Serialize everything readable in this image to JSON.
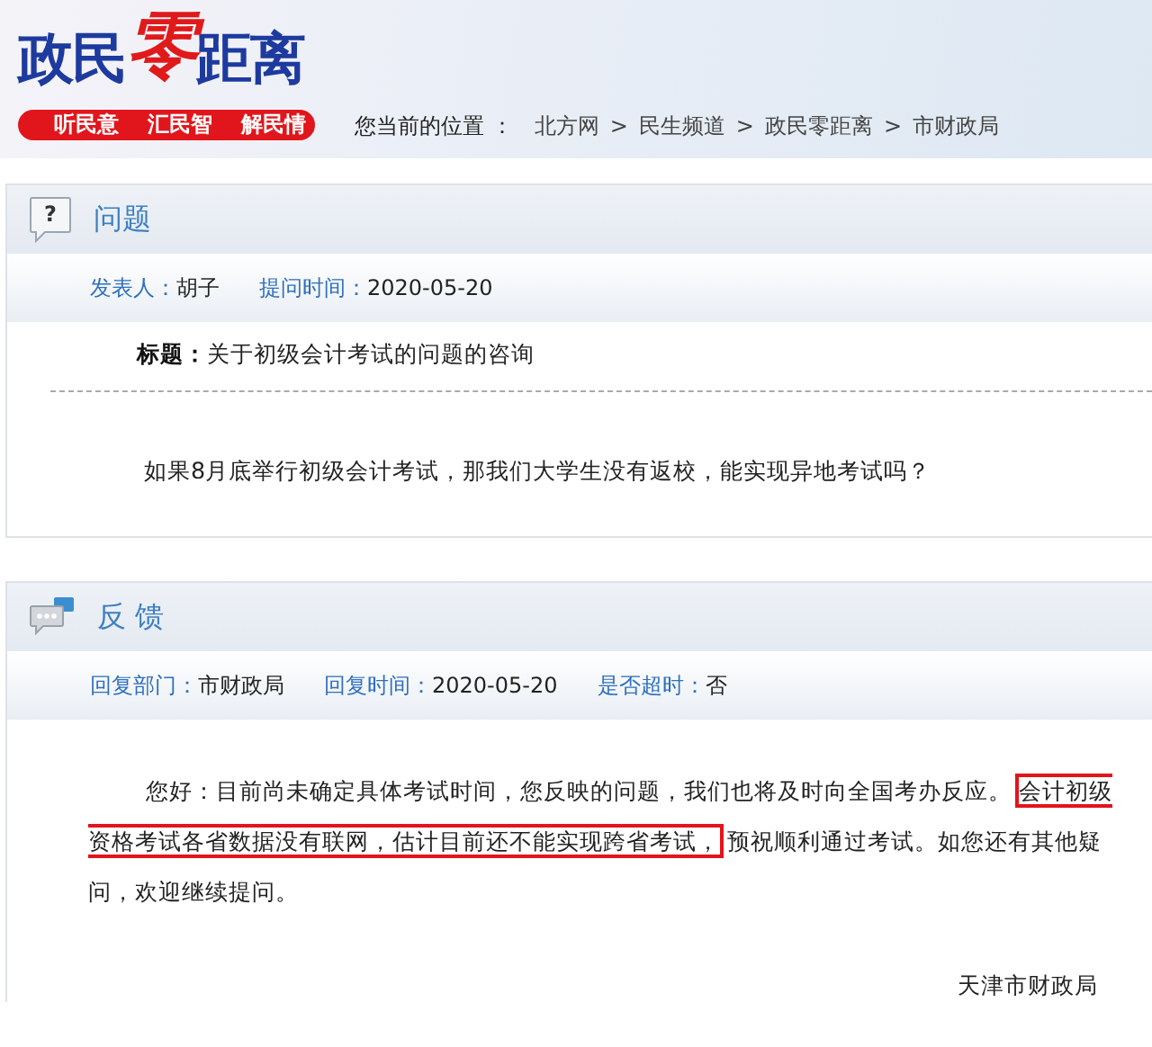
{
  "header": {
    "logo": {
      "before": "政民",
      "accent": "零",
      "after": "距离"
    },
    "slogans": [
      "听民意",
      "汇民智",
      "解民情"
    ],
    "location_label": "您当前的位置 ：",
    "breadcrumb": [
      {
        "text": "北方网"
      },
      {
        "text": "民生频道"
      },
      {
        "text": "政民零距离"
      },
      {
        "text": "市财政局"
      }
    ],
    "separator": ">"
  },
  "panels": [
    {
      "kind": "question",
      "icon_glyph": "?",
      "title": "问题",
      "meta": [
        {
          "label": "发表人：",
          "value": "胡子"
        },
        {
          "label": "提问时间：",
          "value": "2020-05-20"
        }
      ],
      "subject_label": "标题：",
      "subject": "关于初级会计考试的问题的咨询",
      "body": [
        {
          "text": "如果8月底举行初级会计考试，那我们大学生没有返校，能实现异地考试吗？",
          "highlighted": false
        }
      ]
    },
    {
      "kind": "reply",
      "title": "反 馈",
      "meta": [
        {
          "label": "回复部门：",
          "value": "市财政局"
        },
        {
          "label": "回复时间：",
          "value": "2020-05-20"
        },
        {
          "label": "是否超时：",
          "value": "否"
        }
      ],
      "body": [
        {
          "text": "您好：目前尚未确定具体考试时间，您反映的问题，我们也将及时向全国考办反应。",
          "highlighted": false
        },
        {
          "text": "会计初级资格考试各省数据没有联网，估计目前还不能实现跨省考试，",
          "highlighted": true
        },
        {
          "text": "预祝顺利通过考试。如您还有其他疑问，欢迎继续提问。",
          "highlighted": false
        }
      ],
      "signature": "天津市财政局"
    }
  ]
}
